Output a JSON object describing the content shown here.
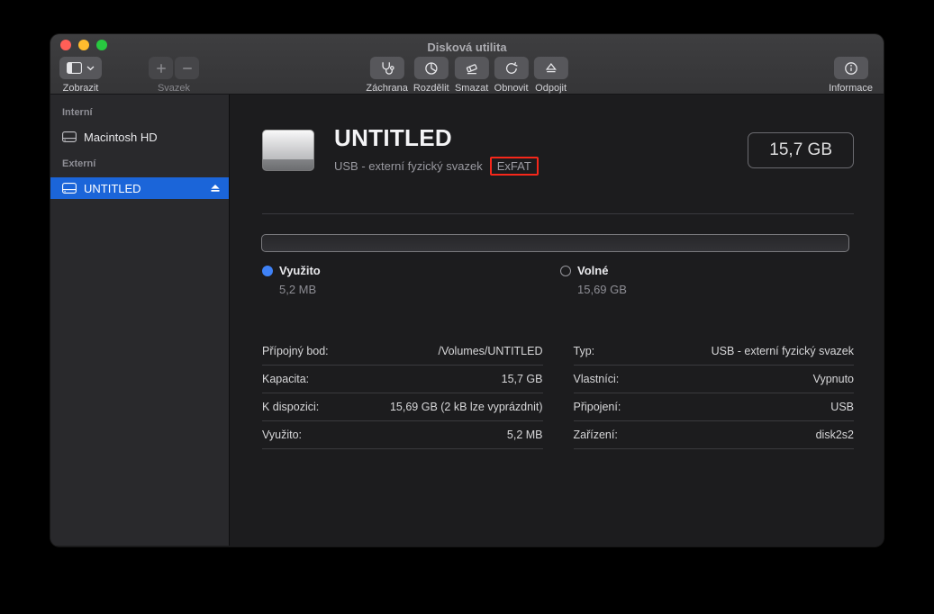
{
  "window": {
    "title": "Disková utilita"
  },
  "toolbar": {
    "view": {
      "label": "Zobrazit"
    },
    "volume": {
      "label": "Svazek"
    },
    "actions": [
      {
        "label": "Záchrana"
      },
      {
        "label": "Rozdělit"
      },
      {
        "label": "Smazat"
      },
      {
        "label": "Obnovit"
      },
      {
        "label": "Odpojit"
      }
    ],
    "info": {
      "label": "Informace"
    }
  },
  "sidebar": {
    "sections": [
      {
        "label": "Interní",
        "items": [
          {
            "label": "Macintosh HD"
          }
        ]
      },
      {
        "label": "Externí",
        "items": [
          {
            "label": "UNTITLED",
            "selected": true
          }
        ]
      }
    ]
  },
  "main": {
    "volume_name": "UNTITLED",
    "volume_type": "USB - externí fyzický svazek",
    "format": "ExFAT",
    "capacity": "15,7 GB",
    "legend": {
      "used_label": "Využito",
      "used_value": "5,2 MB",
      "free_label": "Volné",
      "free_value": "15,69 GB"
    },
    "details_left": [
      {
        "label": "Přípojný bod:",
        "value": "/Volumes/UNTITLED"
      },
      {
        "label": "Kapacita:",
        "value": "15,7 GB"
      },
      {
        "label": "K dispozici:",
        "value": "15,69 GB (2 kB lze vyprázdnit)"
      },
      {
        "label": "Využito:",
        "value": "5,2 MB"
      }
    ],
    "details_right": [
      {
        "label": "Typ:",
        "value": "USB - externí fyzický svazek"
      },
      {
        "label": "Vlastníci:",
        "value": "Vypnuto"
      },
      {
        "label": "Připojení:",
        "value": "USB"
      },
      {
        "label": "Zařízení:",
        "value": "disk2s2"
      }
    ]
  },
  "colors": {
    "selection_blue": "#1b65d9",
    "used_blue": "#3f82f7",
    "annotation_red": "#f6271a"
  }
}
